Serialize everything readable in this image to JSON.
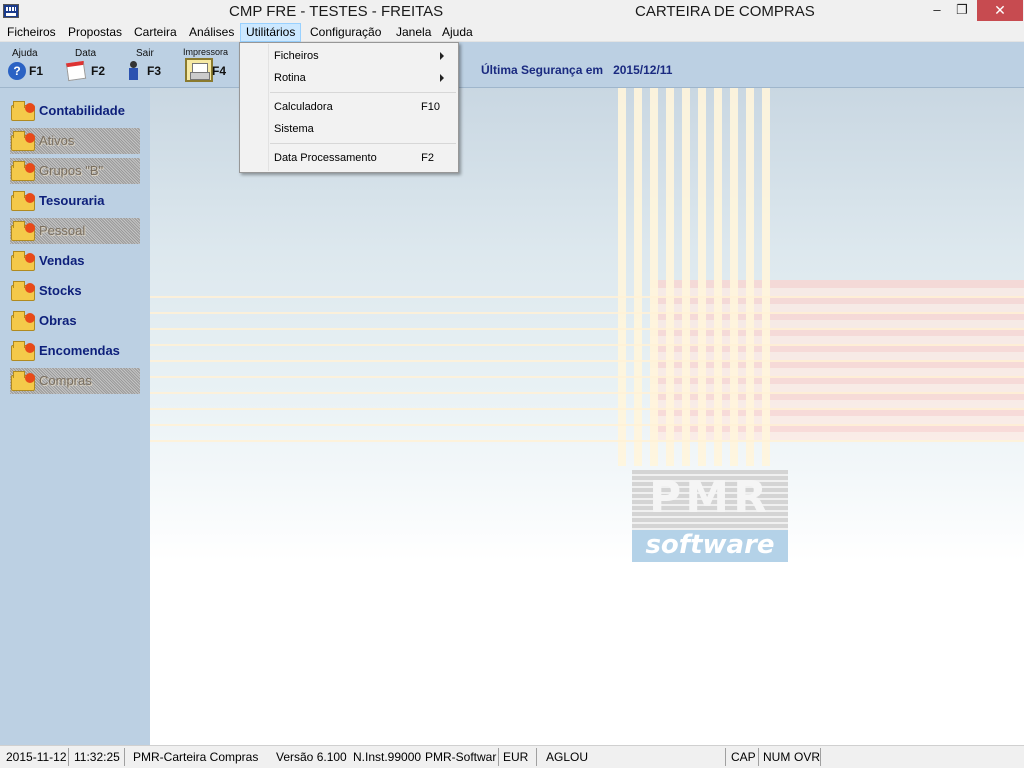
{
  "window": {
    "title_left": "CMP FRE - TESTES - FREITAS",
    "title_right": "CARTEIRA DE COMPRAS",
    "minimize_glyph": "–",
    "maximize_glyph": "❐",
    "close_glyph": "✕"
  },
  "menubar": {
    "items": [
      "Ficheiros",
      "Propostas",
      "Carteira",
      "Análises",
      "Utilitários",
      "Configuração",
      "Janela",
      "Ajuda"
    ],
    "active": "Utilitários"
  },
  "toolbar": {
    "buttons": [
      {
        "caption": "Ajuda",
        "key": "F1",
        "icon": "help-icon",
        "glyph": "?"
      },
      {
        "caption": "Data",
        "key": "F2",
        "icon": "calendar-icon"
      },
      {
        "caption": "Sair",
        "key": "F3",
        "icon": "exit-icon"
      },
      {
        "caption": "Impressora",
        "key": "F4",
        "icon": "printer-icon"
      }
    ],
    "backup_label": "Última Segurança em",
    "backup_date": "2015/12/11"
  },
  "sidebar": {
    "items": [
      {
        "label": "Contabilidade",
        "enabled": true
      },
      {
        "label": "Ativos",
        "enabled": false
      },
      {
        "label": "Grupos \"B\"",
        "enabled": false
      },
      {
        "label": "Tesouraria",
        "enabled": true
      },
      {
        "label": "Pessoal",
        "enabled": false
      },
      {
        "label": "Vendas",
        "enabled": true
      },
      {
        "label": "Stocks",
        "enabled": true
      },
      {
        "label": "Obras",
        "enabled": true
      },
      {
        "label": "Encomendas",
        "enabled": true
      },
      {
        "label": "Compras",
        "enabled": false
      }
    ]
  },
  "dropdown": {
    "items": [
      {
        "label": "Ficheiros",
        "accel": "",
        "submenu": true
      },
      {
        "label": "Rotina",
        "accel": "",
        "submenu": true
      },
      {
        "label": "Calculadora",
        "accel": "F10",
        "submenu": false
      },
      {
        "label": "Sistema",
        "accel": "",
        "submenu": false
      },
      {
        "label": "Data Processamento",
        "accel": "F2",
        "submenu": false
      }
    ]
  },
  "logo": {
    "top": "PMR",
    "bottom": "software"
  },
  "statusbar": {
    "date": "2015-11-12",
    "time": "11:32:25",
    "product": "PMR-Carteira Compras",
    "version": "Versão  6.100",
    "install": "N.Inst.99000",
    "vendor": "PMR-Softwar",
    "currency": "EUR",
    "user": "AGLOU",
    "cap": "CAP",
    "num": "NUM",
    "ovr": "OVR"
  }
}
